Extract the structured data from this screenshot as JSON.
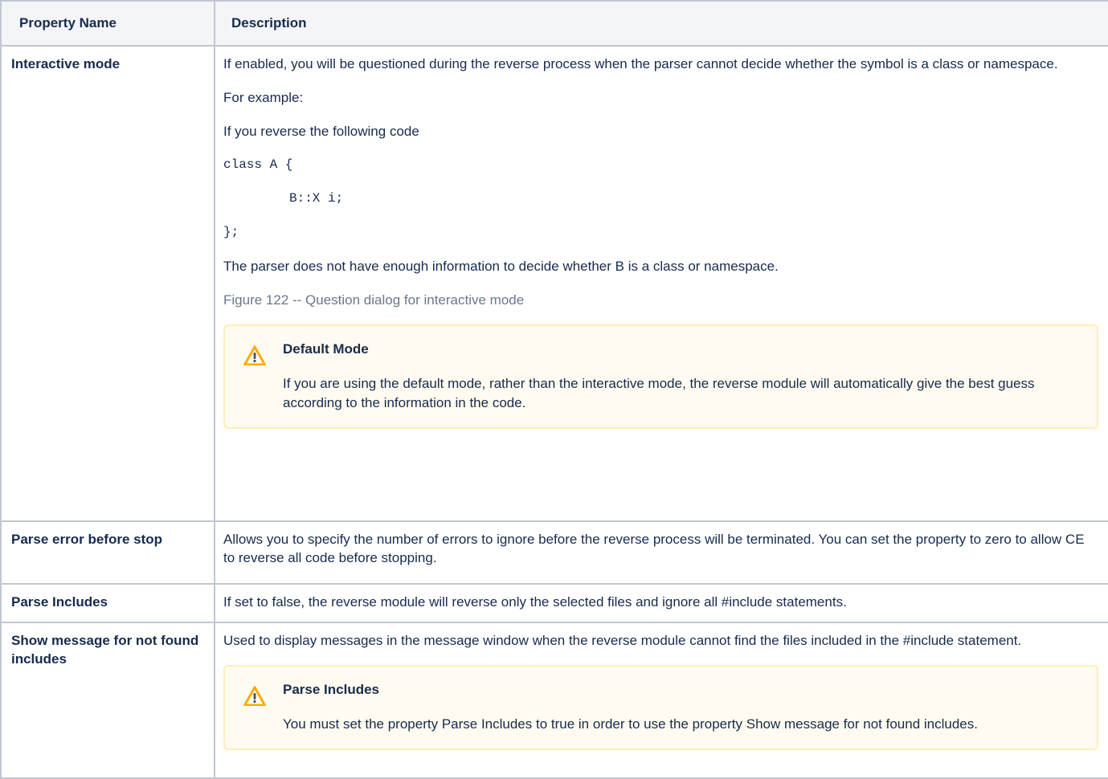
{
  "table": {
    "headers": [
      "Property Name",
      "Description"
    ],
    "rows": {
      "interactive": {
        "name": "Interactive mode",
        "intro": "If enabled, you will be questioned during the reverse process when the parser cannot decide whether the symbol is a class or namespace.",
        "example_label": "For example:",
        "reverse_line": "If you reverse the following code",
        "code": [
          "class A {",
          "B::X i;",
          "};"
        ],
        "explanation": "The parser does not have enough information to decide whether B is a class or namespace.",
        "figure_caption": "Figure 122 -- Question dialog for interactive mode",
        "note": {
          "icon": "warning-icon",
          "title": "Default Mode",
          "body": "If you are using the default mode, rather than the interactive mode, the reverse module will automatically give the best guess according to the information in the code."
        }
      },
      "parse_error": {
        "name": "Parse error before stop",
        "description": "Allows you to specify the number of errors to ignore before the reverse process will be terminated. You can set the property to zero to allow CE to reverse all code before stopping."
      },
      "parse_includes": {
        "name": "Parse Includes",
        "description": "If set to false, the reverse module will reverse only the selected files and ignore all #include statements."
      },
      "show_message": {
        "name": "Show message for not found includes",
        "description": "Used to display messages in the message window when the reverse module cannot find the files included in the #include statement.",
        "note": {
          "icon": "warning-icon",
          "title": "Parse Includes",
          "body": "You must set the property Parse Includes to true in order to use the property Show message for not found includes."
        }
      }
    }
  },
  "colors": {
    "note_border": "#ffeeb7",
    "note_background": "#fffbf0",
    "warning_icon": "#ffab00",
    "caption_text": "#6b778c"
  }
}
